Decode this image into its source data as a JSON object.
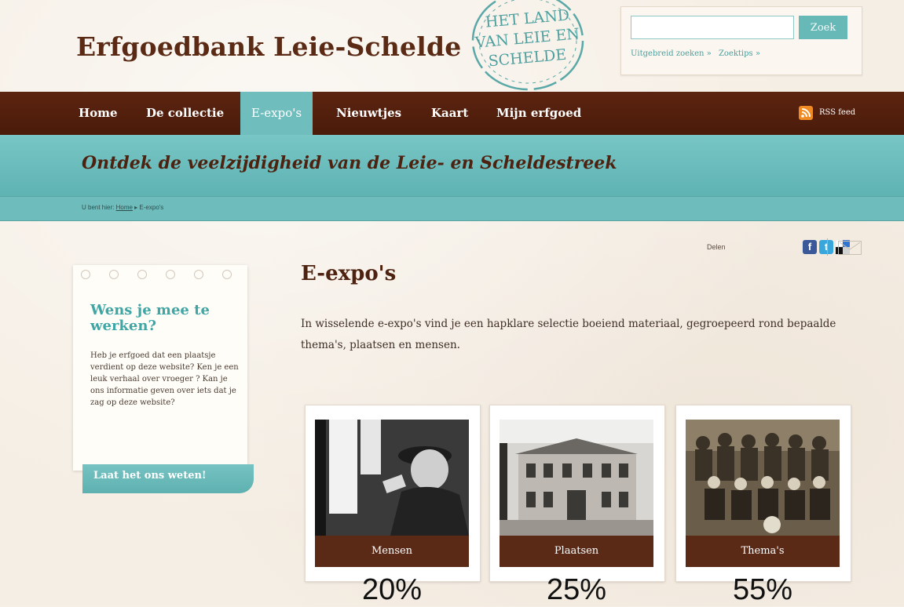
{
  "header": {
    "site_title": "Erfgoedbank Leie-Schelde",
    "stamp_lines": [
      "HET LAND",
      "VAN LEIE EN",
      "SCHELDE"
    ]
  },
  "search": {
    "placeholder": "",
    "button_label": "Zoek",
    "advanced_link": "Uitgebreid zoeken »",
    "tips_link": "Zoektips »"
  },
  "nav": {
    "items": [
      "Home",
      "De collectie",
      "E-expo's",
      "Nieuwtjes",
      "Kaart",
      "Mijn erfgoed"
    ],
    "active": "E-expo's",
    "rss_label": "RSS feed"
  },
  "banner": {
    "tagline": "Ontdek de veelzijdigheid van de Leie- en Scheldestreek"
  },
  "breadcrumb": {
    "prefix": "U bent hier:",
    "home": "Home",
    "current": "E-expo's"
  },
  "share": {
    "label": "Delen"
  },
  "sidebar": {
    "title": "Wens je mee te werken?",
    "body": "Heb je erfgoed dat een plaatsje verdient op deze website? Ken je een leuk verhaal over vroeger ? Kan je ons informatie geven over iets dat je zag op deze website?",
    "cta": "Laat het ons weten!"
  },
  "main": {
    "heading": "E-expo's",
    "intro": "In wisselende e-expo's vind je een hapklare selectie boeiend materiaal, gegroepeerd rond bepaalde thema's, plaatsen en mensen.",
    "cards": [
      {
        "label": "Mensen",
        "percent": "20%"
      },
      {
        "label": "Plaatsen",
        "percent": "25%"
      },
      {
        "label": "Thema's",
        "percent": "55%"
      }
    ]
  },
  "colors": {
    "brown": "#5a2a14",
    "teal": "#6fbdbd",
    "rss": "#ef8b22"
  }
}
